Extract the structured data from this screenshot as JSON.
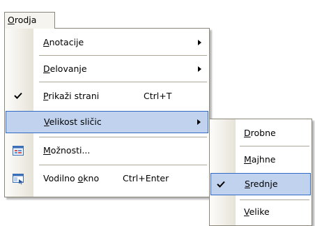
{
  "menubar": {
    "pre": "",
    "u": "O",
    "post": "rodja"
  },
  "menu": {
    "items": [
      {
        "pre": "",
        "u": "A",
        "post": "notacije",
        "shortcut": "",
        "submenu": true
      },
      {
        "pre": "",
        "u": "D",
        "post": "elovanje",
        "shortcut": "",
        "submenu": true
      },
      {
        "pre": "",
        "u": "P",
        "post": "rikaži strani",
        "shortcut": "Ctrl+T",
        "checked": true
      },
      {
        "pre": "",
        "u": "V",
        "post": "elikost sličic",
        "shortcut": "",
        "submenu": true,
        "highlighted": true
      },
      {
        "pre": "",
        "u": "M",
        "post": "ožnosti...",
        "shortcut": "",
        "icon": "options-icon"
      },
      {
        "pre": "Vodilno ",
        "u": "o",
        "post": "kno",
        "shortcut": "Ctrl+Enter",
        "icon": "guide-pane-icon"
      }
    ]
  },
  "submenu": {
    "items": [
      {
        "pre": "",
        "u": "D",
        "post": "robne"
      },
      {
        "pre": "",
        "u": "M",
        "post": "ajhne"
      },
      {
        "pre": "",
        "u": "S",
        "post": "rednje",
        "checked": true,
        "highlighted": true
      },
      {
        "pre": "",
        "u": "V",
        "post": "elike"
      }
    ]
  },
  "colors": {
    "highlight_bg": "#c1d2ee",
    "highlight_border": "#316ac5",
    "menu_border": "#8a867a",
    "gutter": "#e6e3d8",
    "separator": "#aca899"
  }
}
